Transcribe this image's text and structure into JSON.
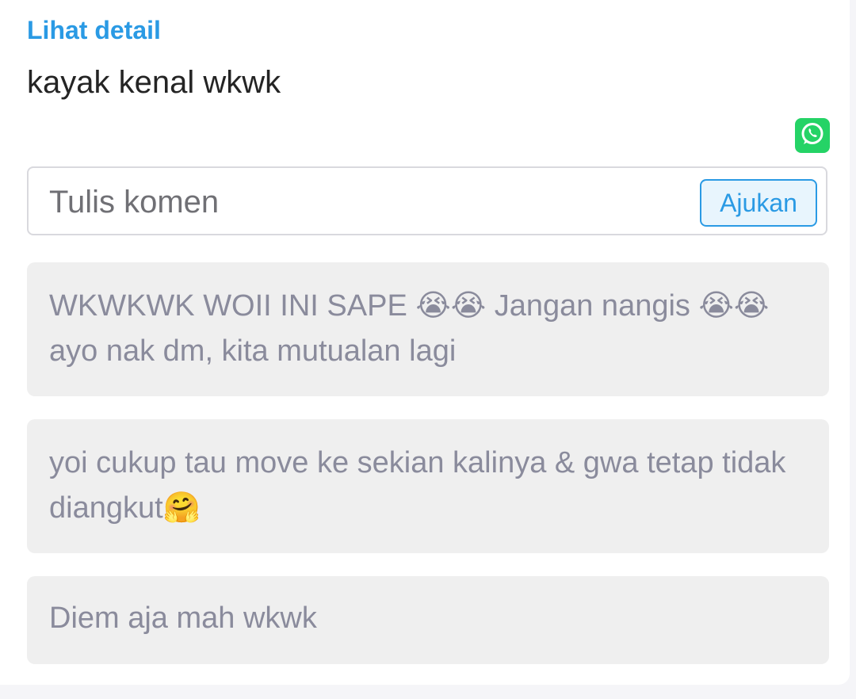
{
  "post": {
    "detail_link": "Lihat detail",
    "text": "kayak kenal wkwk"
  },
  "share": {
    "icon": "whatsapp-icon",
    "color": "#25d366"
  },
  "comment_form": {
    "placeholder": "Tulis komen",
    "submit_label": "Ajukan"
  },
  "comments": [
    {
      "text": "WKWKWK WOII INI SAPE 😭😭 Jangan nangis 😭😭 ayo nak dm, kita mutualan lagi"
    },
    {
      "text": "yoi cukup tau move ke sekian kalinya & gwa tetap tidak diangkut🤗"
    },
    {
      "text": "Diem aja mah wkwk"
    }
  ],
  "colors": {
    "accent": "#2a9ae4",
    "comment_bg": "#efefef",
    "comment_text": "#8a8b9c"
  }
}
